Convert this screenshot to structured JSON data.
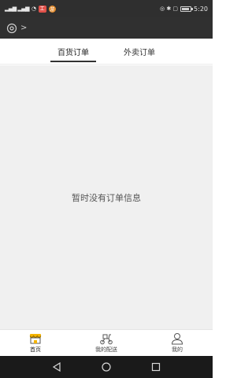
{
  "status_bar": {
    "signal_left": "ʷᴸıll ʷᴸıll",
    "badge1": "工",
    "badge2": "游",
    "right_text": "⦿ ✱ ▢ ⊞",
    "time": "5:20"
  },
  "header": {
    "location_icon": "location-icon",
    "chevron": ">"
  },
  "tabs": [
    {
      "label": "百货订单",
      "active": true
    },
    {
      "label": "外卖订单",
      "active": false
    }
  ],
  "content": {
    "empty_message": "暂时没有订单信息"
  },
  "tabbar": {
    "items": [
      {
        "label": "首页",
        "icon": "shop-icon",
        "active": true
      },
      {
        "label": "我的配送",
        "icon": "scooter-icon",
        "active": false
      },
      {
        "label": "我的",
        "icon": "user-icon",
        "active": false
      }
    ]
  },
  "colors": {
    "status_bar_bg": "#2f2f2f",
    "header_bg": "#303030",
    "content_bg": "#f0f0f0",
    "accent_yellow": "#f4b400",
    "nav_bar_bg": "#1a1a1a"
  }
}
